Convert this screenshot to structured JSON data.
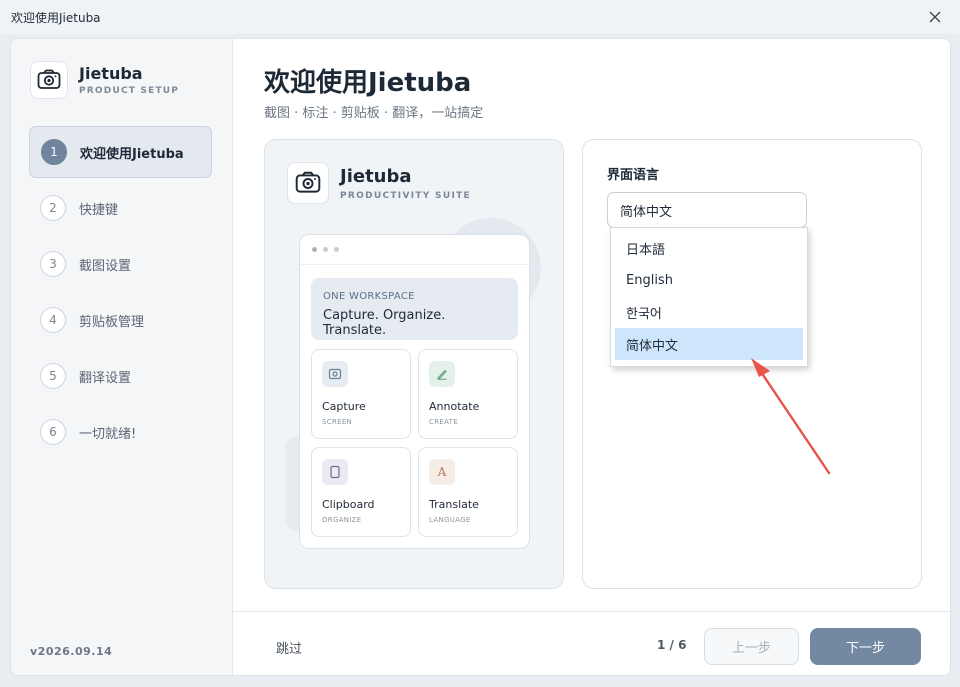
{
  "window": {
    "title": "欢迎使用Jietuba"
  },
  "sidebar": {
    "brand": {
      "name": "Jietuba",
      "subtitle": "PRODUCT SETUP"
    },
    "steps": [
      {
        "num": "1",
        "label": "欢迎使用Jietuba",
        "active": true
      },
      {
        "num": "2",
        "label": "快捷键"
      },
      {
        "num": "3",
        "label": "截图设置"
      },
      {
        "num": "4",
        "label": "剪贴板管理"
      },
      {
        "num": "5",
        "label": "翻译设置"
      },
      {
        "num": "6",
        "label": "一切就绪!"
      }
    ],
    "version": "v2026.09.14"
  },
  "main": {
    "title": "欢迎使用Jietuba",
    "subtitle": "截图 · 标注 · 剪贴板 · 翻译，一站搞定",
    "preview": {
      "brand": {
        "name": "Jietuba",
        "subtitle": "PRODUCTIVITY SUITE"
      },
      "banner": {
        "eyebrow": "ONE WORKSPACE",
        "text": "Capture. Organize. Translate."
      },
      "tiles": [
        {
          "title": "Capture",
          "sub": "SCREEN",
          "icon": "camera-icon",
          "color": "#e6ecf2"
        },
        {
          "title": "Annotate",
          "sub": "CREATE",
          "icon": "pen-icon",
          "color": "#e4f1ea"
        },
        {
          "title": "Clipboard",
          "sub": "ORGANIZE",
          "icon": "clipboard-icon",
          "color": "#ebeaf4"
        },
        {
          "title": "Translate",
          "sub": "LANGUAGE",
          "icon": "letter-a-icon",
          "color": "#f6ece6"
        }
      ]
    },
    "language": {
      "label": "界面语言",
      "selected": "简体中文",
      "options": [
        "日本語",
        "English",
        "한국어",
        "简体中文"
      ]
    }
  },
  "footer": {
    "skip": "跳过",
    "pager": "1 / 6",
    "prev": "上一步",
    "next": "下一步"
  },
  "colors": {
    "accent": "#7389a1",
    "highlight": "#cde6fb",
    "arrow": "#e8534a"
  }
}
